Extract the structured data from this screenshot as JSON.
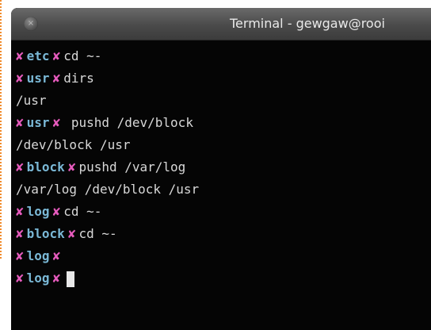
{
  "window": {
    "title": "Terminal - gewgaw@rooi",
    "close_glyph": "×"
  },
  "prompt": {
    "symbol": "✘"
  },
  "lines": [
    {
      "dir": "etc",
      "cmd": "cd ~-"
    },
    {
      "dir": "usr",
      "cmd": "dirs"
    },
    {
      "output": "/usr"
    },
    {
      "dir": "usr",
      "cmd": " pushd /dev/block"
    },
    {
      "output": "/dev/block /usr"
    },
    {
      "dir": "block",
      "cmd": "pushd /var/log"
    },
    {
      "output": "/var/log /dev/block /usr"
    },
    {
      "dir": "log",
      "cmd": "cd ~-"
    },
    {
      "dir": "block",
      "cmd": "cd ~-"
    },
    {
      "dir": "log",
      "cmd": ""
    },
    {
      "dir": "log",
      "cmd": ""
    }
  ],
  "colors": {
    "prompt_symbol": "#e65bbd",
    "directory": "#7ab8d6",
    "text": "#d8d8d8",
    "background": "#050505"
  }
}
